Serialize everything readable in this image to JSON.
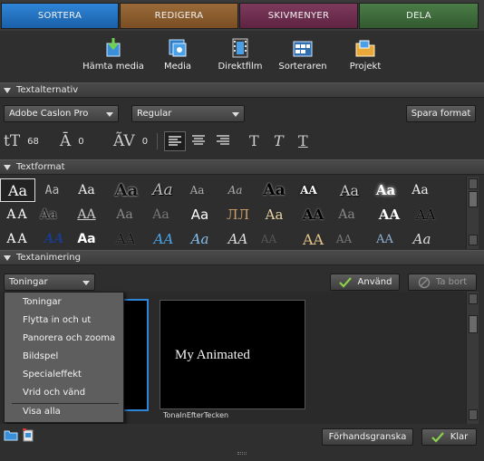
{
  "tabs": [
    {
      "label": "SORTERA",
      "color": "#1f6fbd"
    },
    {
      "label": "REDIGERA",
      "color": "#8a5a2b"
    },
    {
      "label": "SKIVMENYER",
      "color": "#6e2a4e"
    },
    {
      "label": "DELA",
      "color": "#3c6b3a"
    }
  ],
  "toolbar": {
    "items": [
      {
        "label": "Hämta media",
        "icon": "download-media-icon"
      },
      {
        "label": "Media",
        "icon": "media-icon"
      },
      {
        "label": "Direktfilm",
        "icon": "film-icon"
      },
      {
        "label": "Sorteraren",
        "icon": "sorter-icon"
      },
      {
        "label": "Projekt",
        "icon": "project-folder-icon"
      }
    ]
  },
  "text_options": {
    "header": "Textalternativ",
    "font": "Adobe Caslon Pro",
    "style": "Regular",
    "save_format": "Spara format",
    "size": "68",
    "leading": "0",
    "tracking": "0"
  },
  "text_format": {
    "header": "Textformat"
  },
  "text_animation": {
    "header": "Textanimering",
    "selected": "Toningar",
    "apply_label": "Använd",
    "remove_label": "Ta bort",
    "menu_items": [
      "Toningar",
      "Flytta in och ut",
      "Panorera och zooma",
      "Bildspel",
      "Specialeffekt",
      "Vrid och vänd"
    ],
    "menu_show_all": "Visa alla",
    "preview_text": "My Animated",
    "preview_caption": "TonaInEfterTecken"
  },
  "bottom": {
    "preview_label": "Förhandsgranska",
    "done_label": "Klar"
  }
}
